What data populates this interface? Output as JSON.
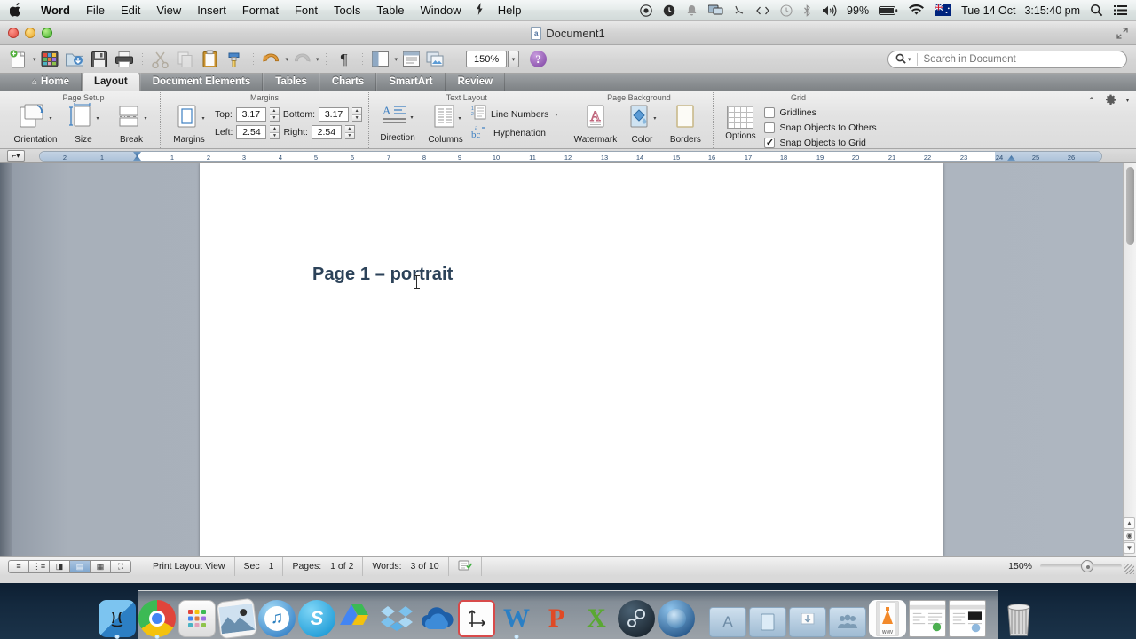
{
  "menubar": {
    "apple_icon": "apple-icon",
    "items": [
      {
        "label": "Word",
        "bold": true
      },
      {
        "label": "File",
        "bold": false
      },
      {
        "label": "Edit",
        "bold": false
      },
      {
        "label": "View",
        "bold": false
      },
      {
        "label": "Insert",
        "bold": false
      },
      {
        "label": "Format",
        "bold": false
      },
      {
        "label": "Font",
        "bold": false
      },
      {
        "label": "Tools",
        "bold": false
      },
      {
        "label": "Table",
        "bold": false
      },
      {
        "label": "Window",
        "bold": false
      }
    ],
    "help_label": "Help",
    "status_icons": [
      "record-icon",
      "timemachine-icon",
      "bell-icon",
      "displays-icon",
      "phone-icon",
      "code-icon",
      "clock-icon",
      "bluetooth-icon",
      "volume-icon"
    ],
    "battery_percent": "99%",
    "battery_icon": "battery-icon",
    "wifi_icon": "wifi-icon",
    "flag_icon": "australia-flag-icon",
    "date": "Tue 14 Oct",
    "time": "3:15:40 pm",
    "spotlight_icon": "search-icon",
    "notification_icon": "notification-center-icon"
  },
  "window": {
    "title": "Document1",
    "title_icon": "word-document-icon",
    "fullscreen_icon": "fullscreen-icon"
  },
  "toolbar": {
    "buttons": [
      {
        "name": "new-document-button",
        "glyph": "📄",
        "caret": true,
        "dim": false
      },
      {
        "name": "media-browser-button",
        "glyph": "▦",
        "caret": false,
        "dim": false
      },
      {
        "name": "open-button",
        "glyph": "📂",
        "caret": false,
        "dim": false
      },
      {
        "name": "save-button",
        "glyph": "💾",
        "caret": false,
        "dim": false
      },
      {
        "name": "print-button",
        "glyph": "🖨",
        "caret": false,
        "dim": false
      },
      {
        "name": "cut-button",
        "glyph": "✂",
        "caret": false,
        "dim": true
      },
      {
        "name": "copy-button",
        "glyph": "⧉",
        "caret": false,
        "dim": true
      },
      {
        "name": "paste-button",
        "glyph": "📋",
        "caret": false,
        "dim": false
      },
      {
        "name": "format-painter-button",
        "glyph": "🖌",
        "caret": false,
        "dim": false
      },
      {
        "name": "undo-button",
        "glyph": "↶",
        "caret": true,
        "dim": false
      },
      {
        "name": "redo-button",
        "glyph": "↷",
        "caret": true,
        "dim": true
      },
      {
        "name": "show-formatting-button",
        "glyph": "¶",
        "caret": false,
        "dim": false
      },
      {
        "name": "sidebar-button",
        "glyph": "◧",
        "caret": true,
        "dim": false
      },
      {
        "name": "notebook-layout-button",
        "glyph": "☰",
        "caret": false,
        "dim": false
      },
      {
        "name": "gallery-button",
        "glyph": "🖼",
        "caret": false,
        "dim": false
      }
    ],
    "zoom_value": "150%",
    "help_label": "?",
    "search_placeholder": "Search in Document",
    "search_value": "",
    "search_icon": "search-icon"
  },
  "ribbon": {
    "tabs": [
      {
        "label": "Home",
        "icon": "home-icon",
        "active": false
      },
      {
        "label": "Layout",
        "icon": "",
        "active": true
      },
      {
        "label": "Document Elements",
        "icon": "",
        "active": false
      },
      {
        "label": "Tables",
        "icon": "",
        "active": false
      },
      {
        "label": "Charts",
        "icon": "",
        "active": false
      },
      {
        "label": "SmartArt",
        "icon": "",
        "active": false
      },
      {
        "label": "Review",
        "icon": "",
        "active": false
      }
    ],
    "collapse_icon": "chevron-up-icon",
    "settings_icon": "gear-icon",
    "groups": {
      "page_setup": {
        "title": "Page Setup",
        "items": [
          {
            "label": "Orientation",
            "icon": "orientation-icon"
          },
          {
            "label": "Size",
            "icon": "page-size-icon"
          },
          {
            "label": "Break",
            "icon": "page-break-icon"
          }
        ]
      },
      "margins": {
        "title": "Margins",
        "button_label": "Margins",
        "button_icon": "margins-icon",
        "fields": [
          {
            "label": "Top:",
            "value": "3.17"
          },
          {
            "label": "Bottom:",
            "value": "3.17"
          },
          {
            "label": "Left:",
            "value": "2.54"
          },
          {
            "label": "Right:",
            "value": "2.54"
          }
        ]
      },
      "text_layout": {
        "title": "Text Layout",
        "items": [
          {
            "label": "Direction",
            "icon": "text-direction-icon"
          },
          {
            "label": "Columns",
            "icon": "columns-icon"
          }
        ],
        "line_numbers_label": "Line Numbers",
        "line_numbers_icon": "line-numbers-icon",
        "hyphenation_label": "Hyphenation",
        "hyphenation_icon": "hyphenation-icon"
      },
      "page_background": {
        "title": "Page Background",
        "items": [
          {
            "label": "Watermark",
            "icon": "watermark-icon"
          },
          {
            "label": "Color",
            "icon": "page-color-icon"
          },
          {
            "label": "Borders",
            "icon": "page-borders-icon"
          }
        ]
      },
      "grid": {
        "title": "Grid",
        "button_label": "Options",
        "button_icon": "grid-options-icon",
        "checkboxes": [
          {
            "label": "Gridlines",
            "checked": false
          },
          {
            "label": "Snap Objects to Others",
            "checked": false
          },
          {
            "label": "Snap Objects to Grid",
            "checked": true
          }
        ]
      }
    }
  },
  "ruler": {
    "tab_selector_icon": "tab-stop-icon",
    "left_numbers": [
      "2",
      "1"
    ],
    "numbers": [
      "1",
      "2",
      "3",
      "4",
      "5",
      "6",
      "7",
      "8",
      "9",
      "10",
      "11",
      "12",
      "13",
      "14",
      "15",
      "16",
      "17",
      "18",
      "19",
      "20",
      "21",
      "22",
      "23",
      "24",
      "25",
      "26"
    ],
    "left_indent_marker": "indent-marker",
    "right_indent_marker": "right-indent-marker"
  },
  "document": {
    "heading": "Page 1 – portrait",
    "cursor": "text-cursor"
  },
  "statusbar": {
    "view_buttons": [
      {
        "name": "draft-view-button",
        "glyph": "≡",
        "active": false
      },
      {
        "name": "outline-view-button",
        "glyph": "≣",
        "active": false
      },
      {
        "name": "publishing-layout-view-button",
        "glyph": "◨",
        "active": false
      },
      {
        "name": "print-layout-view-button",
        "glyph": "▤",
        "active": true
      },
      {
        "name": "notebook-layout-view-button",
        "glyph": "⌸",
        "active": false
      },
      {
        "name": "focus-view-button",
        "glyph": "⛶",
        "active": false
      }
    ],
    "view_label": "Print Layout View",
    "sec_label": "Sec",
    "sec_value": "1",
    "pages_label": "Pages:",
    "pages_value": "1 of 2",
    "words_label": "Words:",
    "words_value": "3 of 10",
    "spelling_icon": "spelling-check-icon",
    "zoom_label": "150%",
    "resize_grip": "resize-grip-icon"
  },
  "dock": {
    "items": [
      {
        "name": "finder",
        "glyph": "◑",
        "shape": "sq",
        "color": "#4da6e8",
        "color2": "#1c6fb5",
        "text": "#ffffff",
        "running": true
      },
      {
        "name": "chrome",
        "glyph": "●",
        "shape": "cir",
        "color": "#e6483c",
        "color2": "#3f8f3f",
        "text": "#ffffff",
        "running": true
      },
      {
        "name": "launchpad",
        "glyph": "⁙",
        "shape": "sq",
        "color": "#f2f2f2",
        "color2": "#d8d8d8",
        "text": "#cc3b33",
        "running": false
      },
      {
        "name": "iphoto",
        "glyph": "📷",
        "shape": "sq",
        "color": "#f7f7f7",
        "color2": "#cfcfcf",
        "text": "#555555",
        "running": false
      },
      {
        "name": "itunes",
        "glyph": "♫",
        "shape": "cir",
        "color": "#6fc8f5",
        "color2": "#1f72c4",
        "text": "#ffffff",
        "running": false
      },
      {
        "name": "skype",
        "glyph": "S",
        "shape": "cir",
        "color": "#55c3f0",
        "color2": "#0a8fd0",
        "text": "#ffffff",
        "running": false
      },
      {
        "name": "google-drive",
        "glyph": "△",
        "shape": "sq",
        "color": "#3cba54",
        "color2": "#f4c20d",
        "text": "#ffffff",
        "running": false
      },
      {
        "name": "dropbox",
        "glyph": "❖",
        "shape": "sq",
        "color": "#9ed2f2",
        "color2": "#3d9ae0",
        "text": "#ffffff",
        "running": false
      },
      {
        "name": "onedrive",
        "glyph": "☁",
        "shape": "sq",
        "color": "#5ba3e0",
        "color2": "#1e5fa8",
        "text": "#ffffff",
        "running": false
      },
      {
        "name": "timeline-app",
        "glyph": "✚",
        "shape": "sq",
        "color": "#ffffff",
        "color2": "#eeeeee",
        "text": "#c23b3b",
        "running": false
      },
      {
        "name": "microsoft-word",
        "glyph": "W",
        "shape": "sq",
        "color": "#2b8ccc",
        "color2": "#1b6fa8",
        "text": "#2b7fc4",
        "running": true
      },
      {
        "name": "microsoft-powerpoint",
        "glyph": "P",
        "shape": "sq",
        "color": "#ffffff",
        "color2": "#f2f2f2",
        "text": "#e04a26",
        "running": false
      },
      {
        "name": "microsoft-excel",
        "glyph": "X",
        "shape": "sq",
        "color": "#ffffff",
        "color2": "#f2f2f2",
        "text": "#5aa832",
        "running": false
      },
      {
        "name": "steam",
        "glyph": "◎",
        "shape": "cir",
        "color": "#2a3b4d",
        "color2": "#101820",
        "text": "#dfe6ec",
        "running": false
      },
      {
        "name": "quicktime",
        "glyph": "◉",
        "shape": "cir",
        "color": "#5fa8e6",
        "color2": "#12457e",
        "text": "#ffffff",
        "running": false
      }
    ],
    "folders": [
      {
        "name": "applications-folder",
        "glyph": "A"
      },
      {
        "name": "documents-folder",
        "glyph": "📄"
      },
      {
        "name": "downloads-folder",
        "glyph": "⤓"
      },
      {
        "name": "shared-folder",
        "glyph": "\u0001F465"
      }
    ],
    "files": [
      {
        "name": "wmv-file",
        "label": "WMV"
      },
      {
        "name": "document-window-1",
        "label": ""
      },
      {
        "name": "document-window-2",
        "label": ""
      }
    ],
    "trash_name": "trash-icon"
  }
}
